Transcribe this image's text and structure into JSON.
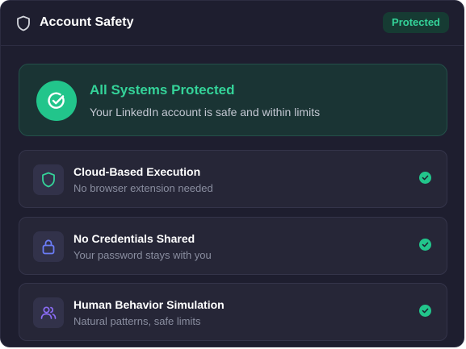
{
  "header": {
    "icon": "shield-icon",
    "title": "Account Safety",
    "badge": "Protected"
  },
  "hero": {
    "icon": "shield-check-icon",
    "title": "All Systems Protected",
    "subtitle": "Your LinkedIn account is safe and within limits"
  },
  "features": [
    {
      "icon": "shield-icon",
      "icon_color": "#34d399",
      "title": "Cloud-Based Execution",
      "subtitle": "No browser extension needed",
      "status_icon": "check-circle-icon"
    },
    {
      "icon": "lock-icon",
      "icon_color": "#6b7cf6",
      "title": "No Credentials Shared",
      "subtitle": "Your password stays with you",
      "status_icon": "check-circle-icon"
    },
    {
      "icon": "users-icon",
      "icon_color": "#8b6cf6",
      "title": "Human Behavior Simulation",
      "subtitle": "Natural patterns, safe limits",
      "status_icon": "check-circle-icon"
    }
  ],
  "colors": {
    "background": "#1e1e2f",
    "card": "#262637",
    "accent_green": "#34d399",
    "hero_background": "#1a3434"
  }
}
